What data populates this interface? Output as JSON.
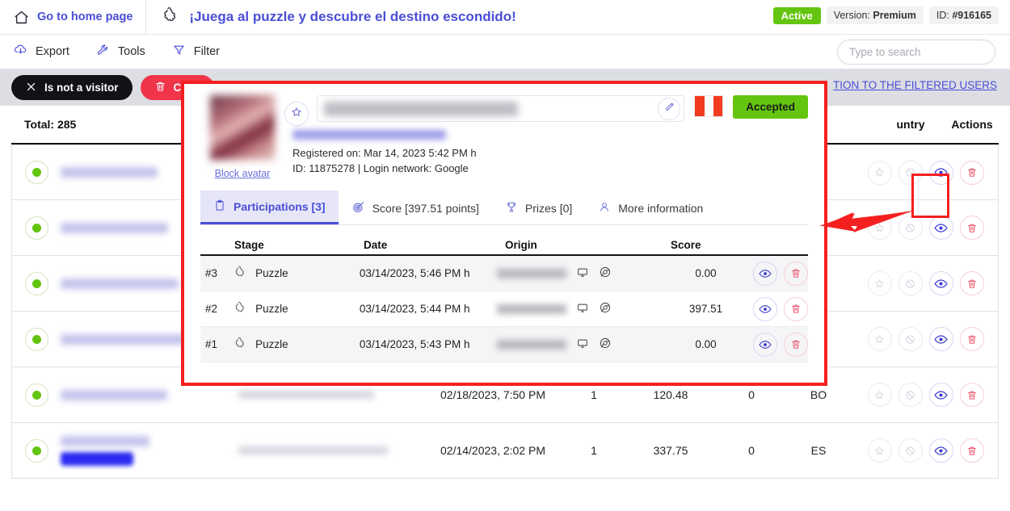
{
  "topbar": {
    "home_label": "Go to home page",
    "home_icon": "home-icon",
    "app_icon": "puzzle-icon",
    "app_title": "¡Juega al puzzle y descubre el destino escondido!",
    "status_badge": "Active",
    "version_label": "Version:",
    "version_value": "Premium",
    "id_label": "ID:",
    "id_value": "#916165"
  },
  "toolbar": {
    "export_label": "Export",
    "export_icon": "download-cloud-icon",
    "tools_label": "Tools",
    "tools_icon": "wrench-icon",
    "filter_label": "Filter",
    "filter_icon": "funnel-icon",
    "search_placeholder": "Type to search",
    "search_value": ""
  },
  "actionbar": {
    "not_visitor_label": "Is not a visitor",
    "not_visitor_icon": "close-x-icon",
    "clear_label": "Clear",
    "clear_icon": "trash-icon",
    "filtered_link": "TION TO THE FILTERED USERS"
  },
  "table": {
    "total_label": "Total: 285",
    "headers": {
      "country": "untry",
      "actions": "Actions"
    },
    "rows": [
      {
        "status": "active",
        "name": "",
        "email": "",
        "date": "",
        "participations": "",
        "score": "",
        "prizes": "",
        "country": "",
        "blurred": true,
        "highlighted": false
      },
      {
        "status": "active",
        "name": "",
        "email": "",
        "date": "",
        "participations": "",
        "score": "",
        "prizes": "",
        "country": "",
        "blurred": true,
        "highlighted": false
      },
      {
        "status": "active",
        "name": "",
        "email": "",
        "date": "",
        "participations": "",
        "score": "",
        "prizes": "",
        "country": "",
        "blurred": true,
        "highlighted": false
      },
      {
        "status": "active",
        "name": "",
        "email": "",
        "date": "",
        "participations": "",
        "score": "",
        "prizes": "",
        "country": "",
        "blurred": true,
        "highlighted": false
      },
      {
        "status": "active",
        "name": "",
        "email": "",
        "date": "02/18/2023, 7:50 PM",
        "participations": "1",
        "score": "120.48",
        "prizes": "0",
        "country": "BO",
        "blurred": true,
        "highlighted": false
      },
      {
        "status": "active",
        "name": "",
        "email": "",
        "date": "02/14/2023, 2:02 PM",
        "participations": "1",
        "score": "337.75",
        "prizes": "0",
        "country": "ES",
        "blurred": true,
        "highlighted": true
      }
    ],
    "row_actions": {
      "star": "star-icon",
      "block": "block-icon",
      "view": "eye-icon",
      "delete": "trash-icon"
    }
  },
  "modal": {
    "avatar_icon": "user-avatar",
    "block_avatar_label": "Block avatar",
    "favorite_icon": "star-icon",
    "name_value": "",
    "edit_icon": "pencil-icon",
    "flag": "PE",
    "accepted_label": "Accepted",
    "email_value": "",
    "registered_line": "Registered on: Mar 14, 2023 5:42 PM h",
    "id_line": "ID: 11875278 | Login network: Google",
    "tabs": [
      {
        "label": "Participations [3]",
        "icon": "clipboard-icon",
        "active": true
      },
      {
        "label": "Score [397.51 points]",
        "icon": "target-icon",
        "active": false
      },
      {
        "label": "Prizes [0]",
        "icon": "trophy-icon",
        "active": false
      },
      {
        "label": "More information",
        "icon": "user-icon",
        "active": false
      }
    ],
    "participations": {
      "headers": [
        "",
        "Stage",
        "Date",
        "Origin",
        "Score"
      ],
      "rows": [
        {
          "num": "#3",
          "stage": "Puzzle",
          "stage_icon": "puzzle-icon",
          "date": "03/14/2023, 5:46 PM h",
          "origin": "",
          "device_icon": "monitor-icon",
          "browser_icon": "chrome-icon",
          "score": "0.00"
        },
        {
          "num": "#2",
          "stage": "Puzzle",
          "stage_icon": "puzzle-icon",
          "date": "03/14/2023, 5:44 PM h",
          "origin": "",
          "device_icon": "monitor-icon",
          "browser_icon": "chrome-icon",
          "score": "397.51"
        },
        {
          "num": "#1",
          "stage": "Puzzle",
          "stage_icon": "puzzle-icon",
          "date": "03/14/2023, 5:43 PM h",
          "origin": "",
          "device_icon": "monitor-icon",
          "browser_icon": "chrome-icon",
          "score": "0.00"
        }
      ],
      "row_actions": {
        "view": "eye-icon",
        "delete": "trash-icon"
      }
    }
  },
  "annotations": {
    "arrow_icon": "red-arrow-left",
    "highlight_box_icon": "red-highlight-box",
    "modal_outline_color": "#f42020"
  },
  "colors": {
    "brand": "#4a4ed6",
    "accent_green": "#63c50f",
    "danger": "#f03449",
    "annotation_red": "#f42020",
    "actionbar_bg": "#dcdee3"
  }
}
